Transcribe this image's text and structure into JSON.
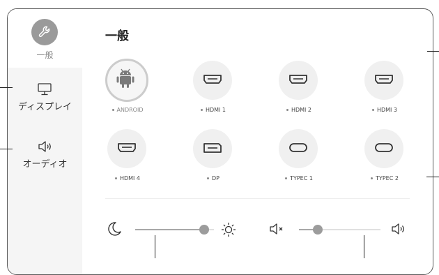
{
  "sidebar": {
    "active": {
      "label": "一般",
      "icon": "wrench-icon"
    },
    "items": [
      {
        "label": "ディスプレイ",
        "icon": "monitor-icon"
      },
      {
        "label": "オーディオ",
        "icon": "speaker-icon"
      }
    ]
  },
  "main": {
    "title": "一般",
    "sources": [
      {
        "label": "ANDROID",
        "icon": "android-icon",
        "selected": true
      },
      {
        "label": "HDMI 1",
        "icon": "hdmi-port-icon"
      },
      {
        "label": "HDMI 2",
        "icon": "hdmi-port-icon"
      },
      {
        "label": "HDMI 3",
        "icon": "hdmi-port-icon"
      },
      {
        "label": "HDMI 4",
        "icon": "hdmi-port-icon"
      },
      {
        "label": "DP",
        "icon": "displayport-icon"
      },
      {
        "label": "TYPEC 1",
        "icon": "usb-c-icon"
      },
      {
        "label": "TYPEC 2",
        "icon": "usb-c-icon"
      }
    ],
    "brightness": {
      "level": 0.88,
      "min_icon": "moon-icon",
      "max_icon": "sun-icon"
    },
    "volume": {
      "level": 0.23,
      "min_icon": "mute-icon",
      "max_icon": "speaker-icon"
    }
  }
}
